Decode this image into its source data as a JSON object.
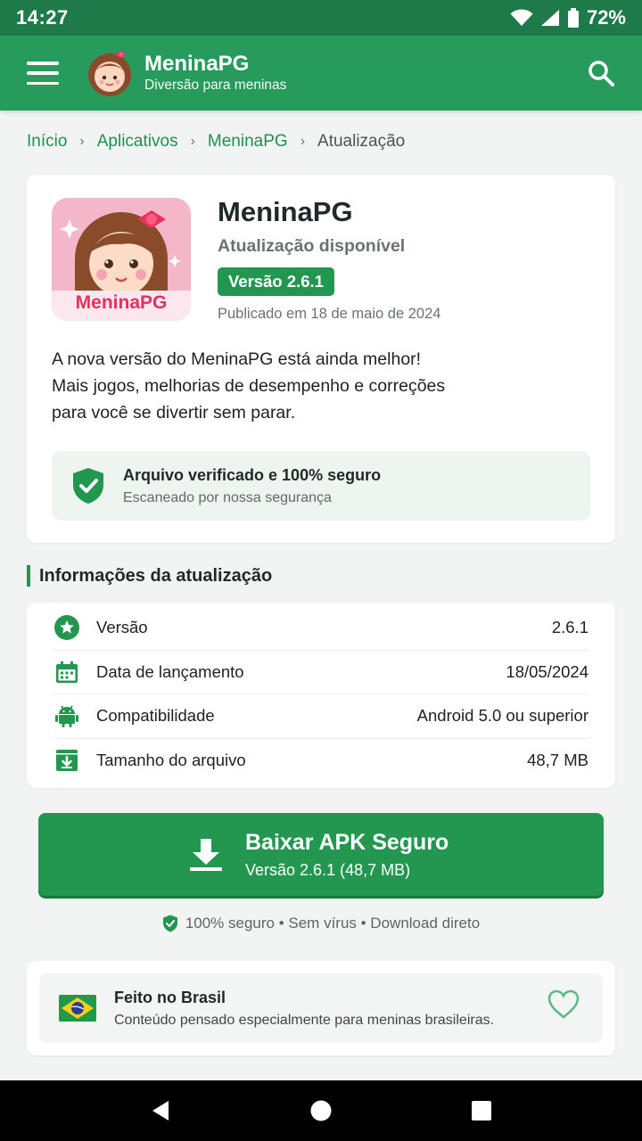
{
  "status_bar": {
    "time": "14:27",
    "battery": "72%"
  },
  "app_bar": {
    "title": "MeninaPG",
    "subtitle": "Diversão para meninas"
  },
  "breadcrumb": {
    "home": "Início",
    "apps": "Aplicativos",
    "app": "MeninaPG",
    "current": "Atualização"
  },
  "hero": {
    "app_name": "MeninaPG",
    "icon_label": "MeninaPG",
    "status": "Atualização disponível",
    "version_badge": "Versão 2.6.1",
    "published": "Publicado em 18 de maio de 2024",
    "description_lines": [
      "A nova versão do MeninaPG está ainda melhor!",
      "Mais jogos, melhorias de desempenho e correções",
      "para você se divertir sem parar."
    ],
    "secure_title": "Arquivo verificado e 100% seguro",
    "secure_sub": "Escaneado por nossa segurança"
  },
  "info_section": {
    "title": "Informações da atualização",
    "rows": [
      {
        "label": "Versão",
        "value": "2.6.1",
        "icon": "star-badge-icon"
      },
      {
        "label": "Data de lançamento",
        "value": "18/05/2024",
        "icon": "calendar-icon"
      },
      {
        "label": "Compatibilidade",
        "value": "Android 5.0 ou superior",
        "icon": "android-icon"
      },
      {
        "label": "Tamanho do arquivo",
        "value": "48,7 MB",
        "icon": "download-box-icon"
      }
    ]
  },
  "download": {
    "title": "Baixar APK Seguro",
    "subtitle": "Versão 2.6.1 (48,7 MB)"
  },
  "safe_note": "100% seguro • Sem vírus • Download direto",
  "brazil": {
    "title": "Feito no Brasil",
    "subtitle": "Conteúdo pensado especialmente para meninas brasileiras."
  },
  "colors": {
    "primary": "#269b5c",
    "primary_dark": "#1e7a49",
    "accent_button": "#23964f",
    "background": "#f2f4f3"
  }
}
